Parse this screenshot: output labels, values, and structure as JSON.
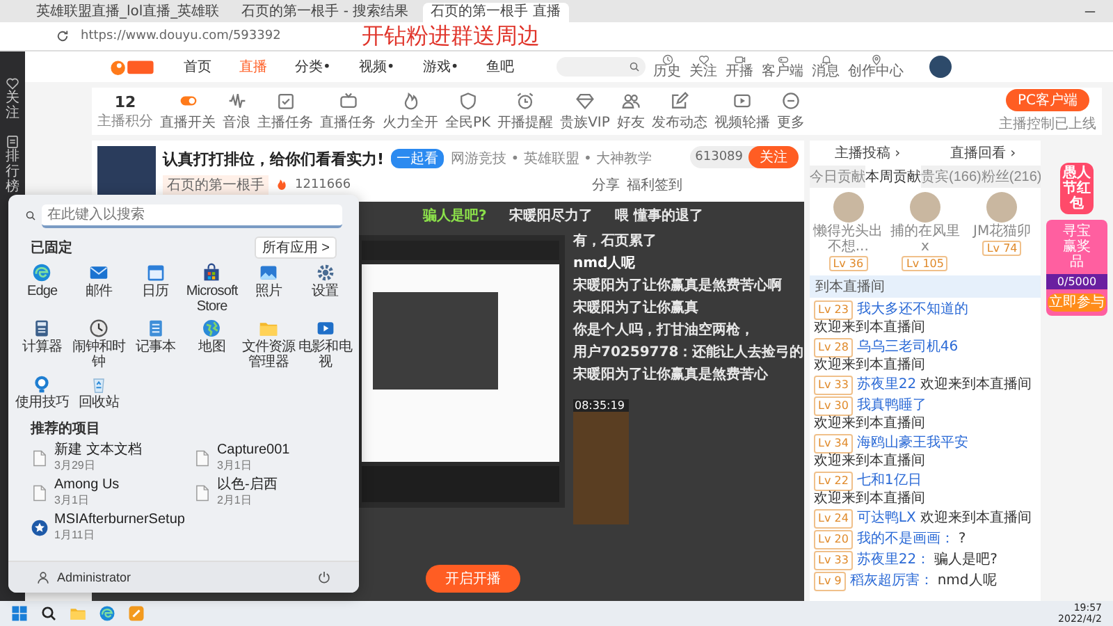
{
  "browser": {
    "tabs": [
      {
        "title": "英雄联盟直播_lol直播_英雄联",
        "selected": false
      },
      {
        "title": "石页的第一根手 - 搜索结果",
        "selected": false
      },
      {
        "title": "石页的第一根手 直播",
        "selected": true
      }
    ],
    "url": "https://www.douyu.com/593392"
  },
  "overlay_caption": "开钻粉进群送周边",
  "site_nav": [
    {
      "label": "首页",
      "selected": false
    },
    {
      "label": "直播",
      "selected": true
    },
    {
      "label": "分类•",
      "selected": false
    },
    {
      "label": "视频•",
      "selected": false
    },
    {
      "label": "游戏•",
      "selected": false
    },
    {
      "label": "鱼吧",
      "selected": false
    }
  ],
  "header_links": [
    "历史",
    "关注",
    "开播",
    "客户端",
    "消息",
    "创作中心"
  ],
  "sidebar": [
    "关注",
    "排行榜"
  ],
  "toolbar": {
    "score": "12",
    "score_label": "主播积分",
    "items": [
      "直播开关",
      "音浪",
      "主播任务",
      "直播任务",
      "火力全开",
      "全民PK",
      "开播提醒",
      "贵族VIP",
      "好友",
      "发布动态",
      "视频轮播",
      "更多"
    ],
    "pc_button": "PC客户端",
    "pc_note": "主播控制已上线"
  },
  "room": {
    "title": "认真打打排位，给你们看看实力!",
    "tag": "一起看",
    "category": "网游竞技 • 英雄联盟 • 大神教学",
    "streamer": "石页的第一根手",
    "hot": "1211666",
    "followers": "613089",
    "follow_button": "关注",
    "share": "分享",
    "checkin": "福利签到"
  },
  "video": {
    "top_danmaku": [
      {
        "text": "骗人是吧?",
        "color": "#8be04a"
      },
      {
        "text": "宋暖阳尽力了",
        "color": "#e8e8e8"
      },
      {
        "text": "喂 懂事的退了",
        "color": "#e8e8e8"
      }
    ],
    "danmaku": [
      {
        "text": "有，石页累了",
        "color": "#e8e8e8"
      },
      {
        "text": "nmd人呢",
        "color": "#ffffff"
      },
      {
        "text": "宋暖阳为了让你赢真是煞费苦心啊",
        "color": "#e8e8e8"
      },
      {
        "text": "宋暖阳为了让你赢真",
        "color": "#e8e8e8"
      },
      {
        "text": "你是个人吗，打甘油空两枪，",
        "color": "#e8e8e8"
      },
      {
        "text": "用户70259778：还能让人去捡弓的",
        "color": "#e8e8e8"
      },
      {
        "text": "宋暖阳为了让你赢真是煞费苦心",
        "color": "#e8e8e8"
      }
    ],
    "timestamp": "08:35:19",
    "start_button": "开启开播"
  },
  "start_menu": {
    "search_placeholder": "在此键入以搜索",
    "pinned_title": "已固定",
    "all_apps": "所有应用 >",
    "apps": [
      "Edge",
      "邮件",
      "日历",
      "Microsoft Store",
      "照片",
      "设置",
      "计算器",
      "闹钟和时钟",
      "记事本",
      "地图",
      "文件资源管理器",
      "电影和电视",
      "使用技巧",
      "回收站"
    ],
    "recommended_title": "推荐的项目",
    "recommended": [
      {
        "name": "新建 文本文档",
        "date": "3月29日",
        "kind": "file"
      },
      {
        "name": "Capture001",
        "date": "3月1日",
        "kind": "file"
      },
      {
        "name": "Among Us",
        "date": "3月1日",
        "kind": "file"
      },
      {
        "name": "以色-启西",
        "date": "2月1日",
        "kind": "file"
      },
      {
        "name": "MSIAfterburnerSetup",
        "date": "1月11日",
        "kind": "installer"
      }
    ],
    "user": "Administrator"
  },
  "side_panel": {
    "links": [
      "主播投稿 ›",
      "直播回看 ›"
    ],
    "tabs": [
      {
        "label": "今日贡献",
        "selected": false
      },
      {
        "label": "本周贡献",
        "selected": true
      },
      {
        "label": "贵宾(166)",
        "selected": false
      },
      {
        "label": "粉丝(216)",
        "selected": false
      }
    ],
    "top_fans": [
      {
        "name": "懒得光头出不想...",
        "level": "Lv 36"
      },
      {
        "name": "捕的在风里x",
        "level": "Lv 105"
      },
      {
        "name": "JM花猫卯",
        "level": "Lv 74"
      }
    ],
    "chat_title": "到本直播间",
    "chat": [
      {
        "level": "Lv 23",
        "name": "我大多还不知道的",
        "message": "欢迎来到本直播间"
      },
      {
        "level": "Lv 28",
        "name": "乌乌三老司机46",
        "message": "欢迎来到本直播间"
      },
      {
        "level": "Lv 33",
        "name": "苏夜里22",
        "message": "欢迎来到本直播间"
      },
      {
        "level": "Lv 30",
        "name": "我真鸭睡了",
        "message": "欢迎来到本直播间"
      },
      {
        "level": "Lv 34",
        "name": "海鸥山豪王我平安",
        "message": "欢迎来到本直播间"
      },
      {
        "level": "Lv 22",
        "name": "七和1亿日",
        "message": "欢迎来到本直播间"
      },
      {
        "level": "Lv 24",
        "name": "可达鸭LX",
        "message": "欢迎来到本直播间"
      },
      {
        "level": "Lv 20",
        "name": "我的不是画画：",
        "message": "?"
      },
      {
        "level": "Lv 33",
        "name": "苏夜里22：",
        "message": "骗人是吧?"
      },
      {
        "level": "Lv 9",
        "name": "稻灰超厉害：",
        "message": "nmd人呢"
      }
    ]
  },
  "promo": {
    "title": "愚人节红包",
    "subtitle": "寻宝赢奖品",
    "progress": "0/5000",
    "level": 0,
    "button": "立即参与"
  },
  "taskbar": {
    "time": "19:57",
    "date": "2022/4/2"
  }
}
